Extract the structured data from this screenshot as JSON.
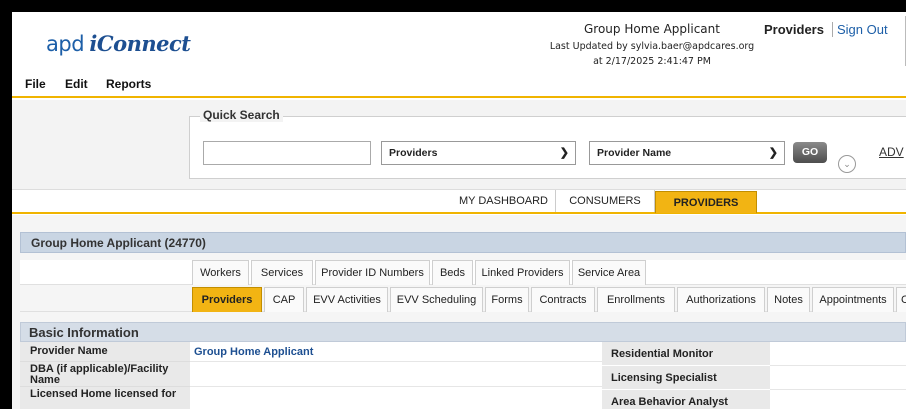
{
  "header": {
    "logo_apd": "apd",
    "logo_iconnect": "iConnect",
    "title": "Group Home Applicant",
    "last_updated_line1": "Last Updated by sylvia.baer@apdcares.org",
    "last_updated_line2": "at 2/17/2025 2:41:47 PM",
    "section": "Providers",
    "sign_out": "Sign Out"
  },
  "menu": {
    "file": "File",
    "edit": "Edit",
    "reports": "Reports"
  },
  "quick_search": {
    "legend": "Quick Search",
    "input_value": "",
    "type_select": "Providers",
    "field_select": "Provider Name",
    "go": "GO",
    "advanced": "ADV",
    "expand_icon": "chevron-circle-down-icon"
  },
  "main_tabs": [
    "MY DASHBOARD",
    "CONSUMERS",
    "PROVIDERS"
  ],
  "provider_header": "Group Home Applicant (24770)",
  "subtabs_row1": [
    "Workers",
    "Services",
    "Provider ID Numbers",
    "Beds",
    "Linked Providers",
    "Service Area"
  ],
  "subtabs_row2": [
    "Providers",
    "CAP",
    "EVV Activities",
    "EVV Scheduling",
    "Forms",
    "Contracts",
    "Enrollments",
    "Authorizations",
    "Notes",
    "Appointments",
    "Cr"
  ],
  "basic_info": {
    "title": "Basic Information",
    "provider_name_label": "Provider Name",
    "provider_name_value": "Group Home Applicant",
    "dba_label": "DBA (if applicable)/Facility Name",
    "licensed_label": "Licensed Home licensed for",
    "residential_monitor": "Residential Monitor",
    "licensing_specialist": "Licensing Specialist",
    "area_behavior_analyst": "Area Behavior Analyst"
  },
  "colors": {
    "accent": "#f2b413",
    "link": "#1d4f91",
    "bar": "#c9d5e3"
  }
}
